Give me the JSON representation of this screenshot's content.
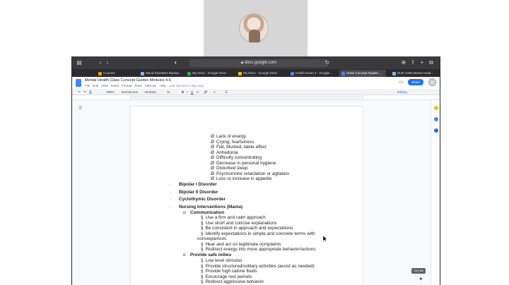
{
  "browser": {
    "url": "docs.google.com",
    "tabs": [
      {
        "label": "Courses",
        "color": "#f29900"
      },
      {
        "label": "Mood Disorders Bipolar...",
        "color": "#8ab4f8"
      },
      {
        "label": "My Drive - Google Drive",
        "color": "#34a853"
      },
      {
        "label": "My Drive - Google Drive",
        "color": "#fbbc04"
      },
      {
        "label": "Health Exam 2 - Google...",
        "color": "#4285f4"
      },
      {
        "label": "Class Concept Guides...",
        "color": "#4285f4"
      },
      {
        "label": "NUR 3405 Mental Healt...",
        "color": "#8ab4f8"
      }
    ]
  },
  "docs": {
    "title": "Mental Health Class Concept Guides Modules 4-6",
    "menu": [
      "File",
      "Edit",
      "View",
      "Insert",
      "Format",
      "Tools",
      "Add-ons",
      "Help"
    ],
    "last_edit": "Last edit was 6 days ago",
    "share_label": "Share",
    "toolbar": {
      "zoom": "100%",
      "style": "Normal text",
      "font": "Verdana",
      "size": "11",
      "mode": "Editing"
    },
    "kbd_hint": "Ctrl+Alt"
  },
  "content": [
    {
      "marker": "Ø",
      "text": "Lack of energy",
      "indent": 2,
      "bold": false
    },
    {
      "marker": "Ø",
      "text": "Crying, fearfulness",
      "indent": 2,
      "bold": false
    },
    {
      "marker": "Ø",
      "text": "Flat, blunted, labile affect",
      "indent": 2,
      "bold": false
    },
    {
      "marker": "Ø",
      "text": "Anhedonia",
      "indent": 2,
      "bold": false
    },
    {
      "marker": "Ø",
      "text": "Difficulty concentrating",
      "indent": 2,
      "bold": false
    },
    {
      "marker": "Ø",
      "text": "Decrease in personal hygiene",
      "indent": 2,
      "bold": false
    },
    {
      "marker": "Ø",
      "text": "Disturbed sleep",
      "indent": 2,
      "bold": false
    },
    {
      "marker": "Ø",
      "text": "Psychomotor retardation or agitation",
      "indent": 2,
      "bold": false
    },
    {
      "marker": "Ø",
      "text": "Loss or increase in appetite",
      "indent": 2,
      "bold": false
    },
    {
      "marker": "·",
      "text": "Bipolar I Disorder",
      "indent": 0,
      "bold": true
    },
    {
      "marker": "·",
      "text": "Bipolar II Disorder",
      "indent": 0,
      "bold": true
    },
    {
      "marker": "·",
      "text": "Cyclothymic Disorder",
      "indent": 0,
      "bold": true
    },
    {
      "marker": "·",
      "text": "Nursing Interventions (Mania)",
      "indent": 0,
      "bold": true
    },
    {
      "marker": "o",
      "text": "Communication",
      "indent": 1,
      "bold": true
    },
    {
      "marker": "§",
      "text": "Use a firm and calm approach",
      "indent": 3,
      "bold": false
    },
    {
      "marker": "§",
      "text": "Use short and concise explanations",
      "indent": 3,
      "bold": false
    },
    {
      "marker": "§",
      "text": "Be consistent in approach and expectations",
      "indent": 3,
      "bold": false
    },
    {
      "marker": "§",
      "text": "Identify expectations in simple and concrete terms with",
      "indent": 3,
      "bold": false
    },
    {
      "marker": "",
      "text": "consequences",
      "indent": 4,
      "bold": false
    },
    {
      "marker": "§",
      "text": "Hear and act on legitimate complaints",
      "indent": 3,
      "bold": false
    },
    {
      "marker": "§",
      "text": "Redirect energy into more appropriate behavior/actions",
      "indent": 3,
      "bold": false
    },
    {
      "marker": "o",
      "text": "Provide safe milieu",
      "indent": 1,
      "bold": true
    },
    {
      "marker": "§",
      "text": "Low level stimulus",
      "indent": 3,
      "bold": false
    },
    {
      "marker": "§",
      "text": "Provide structured/solitary activities (assist as needed)",
      "indent": 3,
      "bold": false
    },
    {
      "marker": "§",
      "text": "Provide high calorie fluids",
      "indent": 3,
      "bold": false
    },
    {
      "marker": "§",
      "text": "Encourage rest periods",
      "indent": 3,
      "bold": false
    },
    {
      "marker": "§",
      "text": "Redirect aggressive behavior",
      "indent": 3,
      "bold": false
    }
  ]
}
